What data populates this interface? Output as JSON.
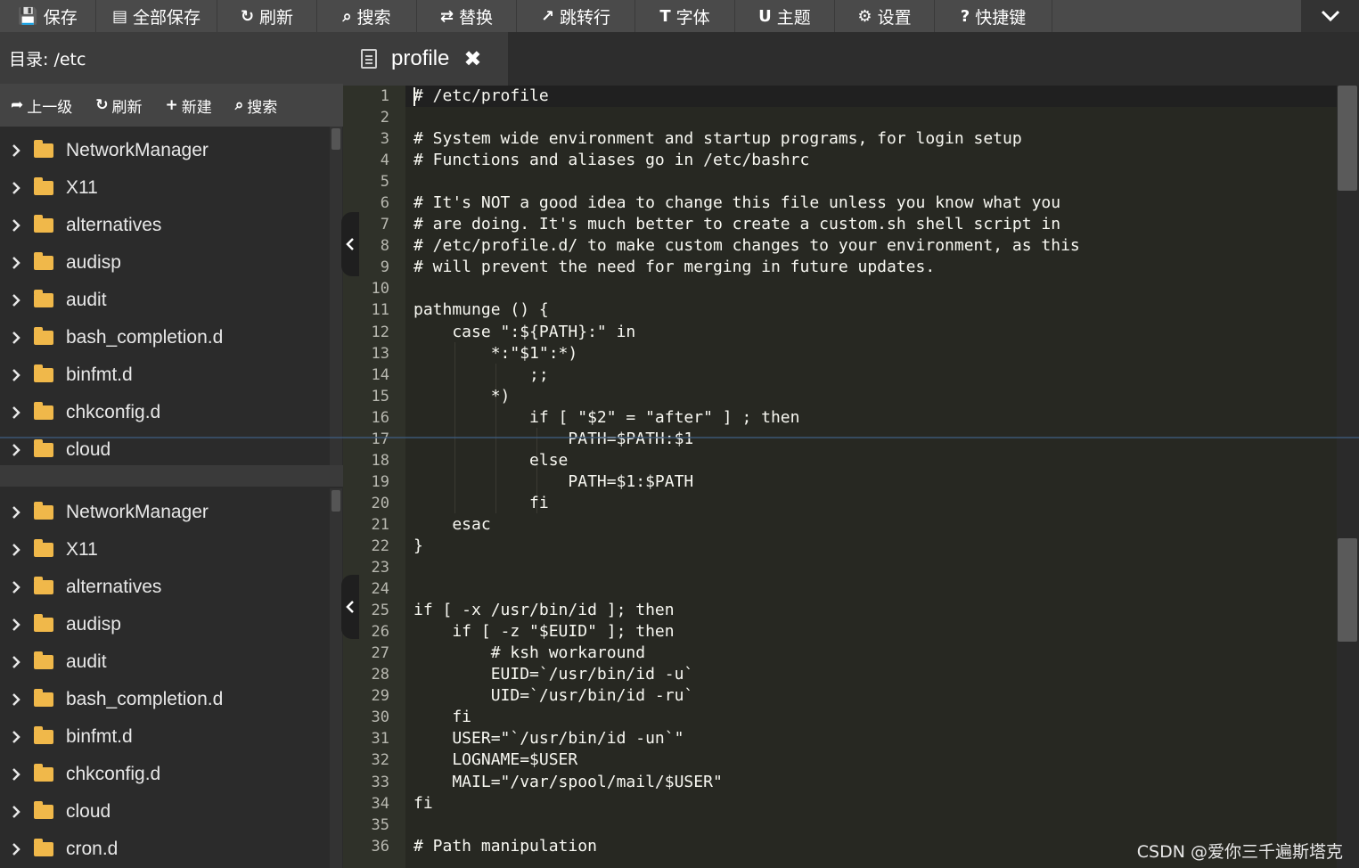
{
  "toolbar": {
    "buttons": [
      {
        "label": "保存",
        "icon": "save-icon",
        "glyph": "💾"
      },
      {
        "label": "全部保存",
        "icon": "save-all-icon",
        "glyph": "▤"
      },
      {
        "label": "刷新",
        "icon": "refresh-icon",
        "glyph": "↻"
      },
      {
        "label": "搜索",
        "icon": "search-icon",
        "glyph": "⌕"
      },
      {
        "label": "替换",
        "icon": "replace-icon",
        "glyph": "⇄"
      },
      {
        "label": "跳转行",
        "icon": "goto-line-icon",
        "glyph": "↗"
      },
      {
        "label": "字体",
        "icon": "font-icon",
        "glyph": "T"
      },
      {
        "label": "主题",
        "icon": "theme-icon",
        "glyph": "U"
      },
      {
        "label": "设置",
        "icon": "settings-icon",
        "glyph": "⚙"
      },
      {
        "label": "快捷键",
        "icon": "help-icon",
        "glyph": "?"
      }
    ],
    "collapse_icon": "chevron-down-icon"
  },
  "sidebar": {
    "dir_label": "目录: /etc",
    "tools": [
      {
        "label": "上一级",
        "icon": "up-level-icon",
        "glyph": "➦"
      },
      {
        "label": "刷新",
        "icon": "refresh-icon",
        "glyph": "↻"
      },
      {
        "label": "新建",
        "icon": "plus-icon",
        "glyph": "+"
      },
      {
        "label": "搜索",
        "icon": "search-icon",
        "glyph": "⌕"
      }
    ],
    "tree_top": [
      "NetworkManager",
      "X11",
      "alternatives",
      "audisp",
      "audit",
      "bash_completion.d",
      "binfmt.d",
      "chkconfig.d",
      "cloud"
    ],
    "tree_bottom": [
      "NetworkManager",
      "X11",
      "alternatives",
      "audisp",
      "audit",
      "bash_completion.d",
      "binfmt.d",
      "chkconfig.d",
      "cloud",
      "cron.d"
    ]
  },
  "tab": {
    "label": "profile",
    "close_glyph": "✖"
  },
  "editor": {
    "lines": [
      "# /etc/profile",
      "",
      "# System wide environment and startup programs, for login setup",
      "# Functions and aliases go in /etc/bashrc",
      "",
      "# It's NOT a good idea to change this file unless you know what you",
      "# are doing. It's much better to create a custom.sh shell script in",
      "# /etc/profile.d/ to make custom changes to your environment, as this",
      "# will prevent the need for merging in future updates.",
      "",
      "pathmunge () {",
      "    case \":${PATH}:\" in",
      "        *:\"$1\":*)",
      "            ;;",
      "        *)",
      "            if [ \"$2\" = \"after\" ] ; then",
      "                PATH=$PATH:$1",
      "            else",
      "                PATH=$1:$PATH",
      "            fi",
      "    esac",
      "}",
      "",
      "",
      "if [ -x /usr/bin/id ]; then",
      "    if [ -z \"$EUID\" ]; then",
      "        # ksh workaround",
      "        EUID=`/usr/bin/id -u`",
      "        UID=`/usr/bin/id -ru`",
      "    fi",
      "    USER=\"`/usr/bin/id -un`\"",
      "    LOGNAME=$USER",
      "    MAIL=\"/var/spool/mail/$USER\"",
      "fi",
      "",
      "# Path manipulation"
    ]
  },
  "watermark": "CSDN @爱你三千遍斯塔克",
  "colors": {
    "toolbar_bg": "#4a4a4a",
    "sidebar_bg": "#2b2b2b",
    "editor_bg": "#272822",
    "folder": "#f0b84a",
    "text": "#f8f8f2"
  }
}
